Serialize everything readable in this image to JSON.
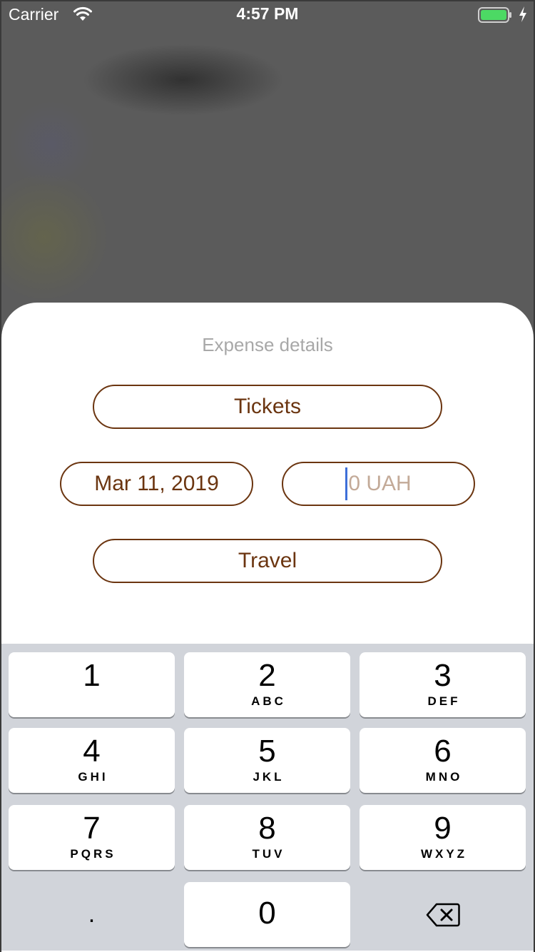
{
  "status_bar": {
    "carrier": "Carrier",
    "time": "4:57 PM",
    "battery_color": "#4cd964"
  },
  "sheet": {
    "title": "Expense details",
    "name_value": "Tickets",
    "date_value": "Mar 11, 2019",
    "amount_placeholder": "0 UAH",
    "category_value": "Travel",
    "accent_color": "#6b3510"
  },
  "keyboard": {
    "keys": [
      {
        "digit": "1",
        "letters": ""
      },
      {
        "digit": "2",
        "letters": "ABC"
      },
      {
        "digit": "3",
        "letters": "DEF"
      },
      {
        "digit": "4",
        "letters": "GHI"
      },
      {
        "digit": "5",
        "letters": "JKL"
      },
      {
        "digit": "6",
        "letters": "MNO"
      },
      {
        "digit": "7",
        "letters": "PQRS"
      },
      {
        "digit": "8",
        "letters": "TUV"
      },
      {
        "digit": "9",
        "letters": "WXYZ"
      },
      {
        "digit": "0",
        "letters": ""
      }
    ],
    "decimal": ".",
    "delete_icon": "delete-backward-icon"
  }
}
